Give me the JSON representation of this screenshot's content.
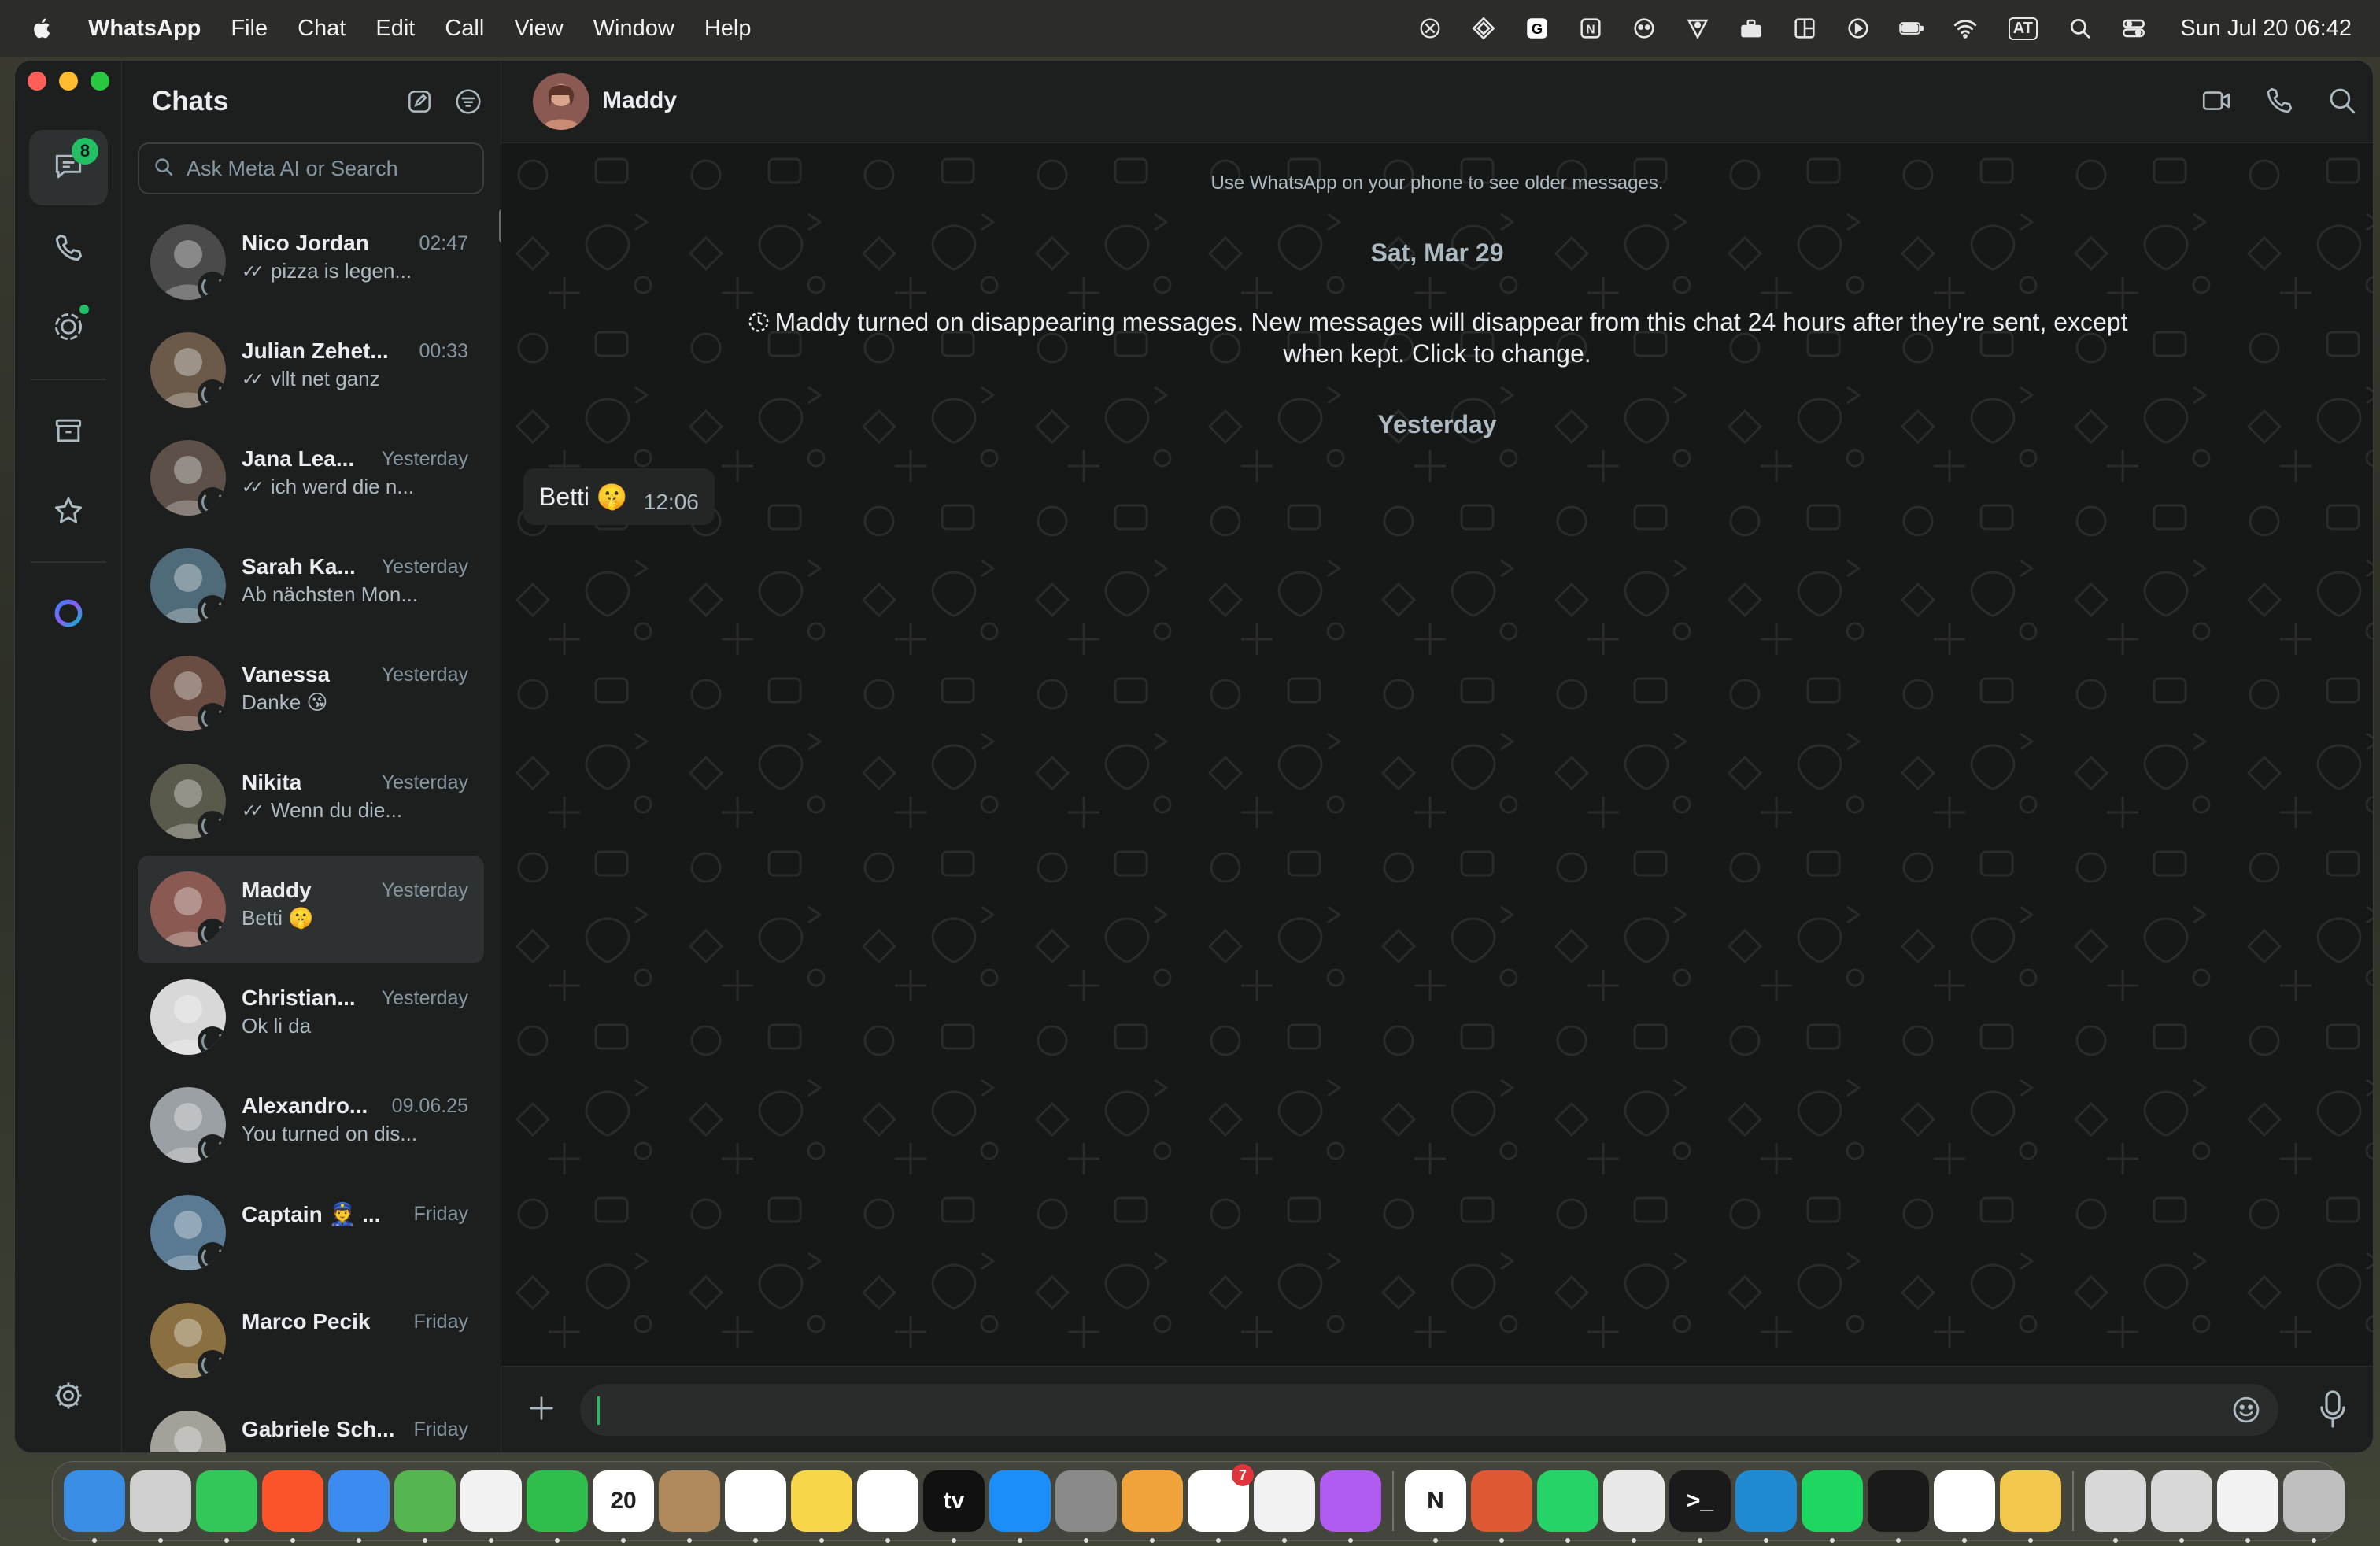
{
  "menubar": {
    "app_name": "WhatsApp",
    "items": [
      "File",
      "Chat",
      "Edit",
      "Call",
      "View",
      "Window",
      "Help"
    ],
    "status_icons": [
      "chatgpt-icon",
      "diamond-icon",
      "grammarly-icon",
      "notion-icon",
      "copilot-icon",
      "vpn-icon",
      "toolbox-icon",
      "window-manager-icon",
      "play-icon",
      "battery-icon",
      "wifi-icon",
      "input-source-icon",
      "spotlight-icon",
      "control-center-icon"
    ],
    "input_source": "AT",
    "clock": "Sun Jul 20  06:42"
  },
  "rail": {
    "chats_badge": "8",
    "items": [
      "chats-icon",
      "calls-icon",
      "status-icon",
      "archive-icon",
      "starred-icon",
      "meta-ai-icon",
      "settings-icon"
    ]
  },
  "chatlist": {
    "title": "Chats",
    "search_placeholder": "Ask Meta AI or Search",
    "chats": [
      {
        "name": "Nico Jordan",
        "time": "02:47",
        "preview": "pizza is legen...",
        "read": true,
        "selected": false,
        "avatar_color": "#4a4a4a"
      },
      {
        "name": "Julian Zehet...",
        "time": "00:33",
        "preview": "vllt net ganz",
        "read": true,
        "selected": false,
        "avatar_color": "#6b5a4a"
      },
      {
        "name": "Jana Lea...",
        "time": "Yesterday",
        "preview": "ich werd die n...",
        "read": true,
        "selected": false,
        "avatar_color": "#5c5048"
      },
      {
        "name": "Sarah Ka...",
        "time": "Yesterday",
        "preview": "Ab nächsten Mon...",
        "read": false,
        "selected": false,
        "avatar_color": "#4f6a78"
      },
      {
        "name": "Vanessa",
        "time": "Yesterday",
        "preview": "Danke 😘",
        "read": false,
        "selected": false,
        "avatar_color": "#6a4d42"
      },
      {
        "name": "Nikita",
        "time": "Yesterday",
        "preview": "Wenn du die...",
        "read": true,
        "selected": false,
        "avatar_color": "#5a5a4c"
      },
      {
        "name": "Maddy",
        "time": "Yesterday",
        "preview": "Betti 🤫",
        "read": false,
        "selected": true,
        "avatar_color": "#8a5a52"
      },
      {
        "name": "Christian...",
        "time": "Yesterday",
        "preview": "Ok li da",
        "read": false,
        "selected": false,
        "avatar_color": "#d8d8d8"
      },
      {
        "name": "Alexandro...",
        "time": "09.06.25",
        "preview": "You turned on dis...",
        "read": false,
        "selected": false,
        "avatar_color": "#9aa0a4"
      },
      {
        "name": "Captain 👮 ...",
        "time": "Friday",
        "preview": "",
        "read": false,
        "selected": false,
        "avatar_color": "#5a7a94"
      },
      {
        "name": "Marco Pecik",
        "time": "Friday",
        "preview": "",
        "read": false,
        "selected": false,
        "avatar_color": "#8a7040"
      },
      {
        "name": "Gabriele Sch...",
        "time": "Friday",
        "preview": "",
        "read": false,
        "selected": false,
        "avatar_color": "#a4a09a"
      }
    ]
  },
  "conversation": {
    "contact_name": "Maddy",
    "older_notice": "Use WhatsApp on your phone to see older messages.",
    "date_1": "Sat, Mar 29",
    "system_message": "Maddy turned on disappearing messages. New messages will disappear from this chat 24 hours after they're sent, except when kept. Click to change.",
    "date_2": "Yesterday",
    "message_text": "Betti 🤫",
    "message_time": "12:06"
  },
  "dock": {
    "apps": [
      {
        "name": "finder",
        "color": "#3a8ee6",
        "label": ""
      },
      {
        "name": "launchpad",
        "color": "#d0d0d0",
        "label": ""
      },
      {
        "name": "messages",
        "color": "#33c659",
        "label": ""
      },
      {
        "name": "brave",
        "color": "#fb542b",
        "label": ""
      },
      {
        "name": "mail",
        "color": "#3b8bf0",
        "label": ""
      },
      {
        "name": "maps",
        "color": "#55b54f",
        "label": ""
      },
      {
        "name": "photos",
        "color": "#f2f2f2",
        "label": ""
      },
      {
        "name": "facetime",
        "color": "#2fbd4b",
        "label": ""
      },
      {
        "name": "calendar",
        "color": "#ffffff",
        "label": "20"
      },
      {
        "name": "contacts",
        "color": "#b08a5c",
        "label": ""
      },
      {
        "name": "reminders",
        "color": "#ffffff",
        "label": ""
      },
      {
        "name": "notes",
        "color": "#f7d64a",
        "label": ""
      },
      {
        "name": "freeform",
        "color": "#ffffff",
        "label": ""
      },
      {
        "name": "apple-tv",
        "color": "#111111",
        "label": "tv"
      },
      {
        "name": "app-store",
        "color": "#1c8ef9",
        "label": ""
      },
      {
        "name": "system-settings",
        "color": "#8a8a8a",
        "label": ""
      },
      {
        "name": "pages",
        "color": "#f0a33a",
        "label": ""
      },
      {
        "name": "spark-mail",
        "color": "#ffffff",
        "label": ""
      },
      {
        "name": "vpn-app",
        "color": "#f2f2f2",
        "label": ""
      },
      {
        "name": "shortcuts",
        "color": "#b05cf0",
        "label": ""
      },
      {
        "name": "notion",
        "color": "#ffffff",
        "label": "N"
      },
      {
        "name": "duckduckgo",
        "color": "#de5833",
        "label": ""
      },
      {
        "name": "whatsapp",
        "color": "#25d366",
        "label": ""
      },
      {
        "name": "chrome",
        "color": "#e8e8e8",
        "label": ""
      },
      {
        "name": "terminal",
        "color": "#1a1a1a",
        "label": ">_"
      },
      {
        "name": "vscode",
        "color": "#1f8ad2",
        "label": ""
      },
      {
        "name": "spotify",
        "color": "#1ed760",
        "label": ""
      },
      {
        "name": "activity-monitor",
        "color": "#1a1a1a",
        "label": ""
      },
      {
        "name": "chatgpt",
        "color": "#ffffff",
        "label": ""
      },
      {
        "name": "python",
        "color": "#f2c94c",
        "label": ""
      },
      {
        "name": "documents-folder",
        "color": "#d8d8d8",
        "label": ""
      },
      {
        "name": "downloads-folder",
        "color": "#d8d8d8",
        "label": ""
      },
      {
        "name": "desktop-folder",
        "color": "#f2f2f2",
        "label": ""
      },
      {
        "name": "trash",
        "color": "#bfbfbf",
        "label": ""
      }
    ],
    "mail_badge": "7"
  }
}
